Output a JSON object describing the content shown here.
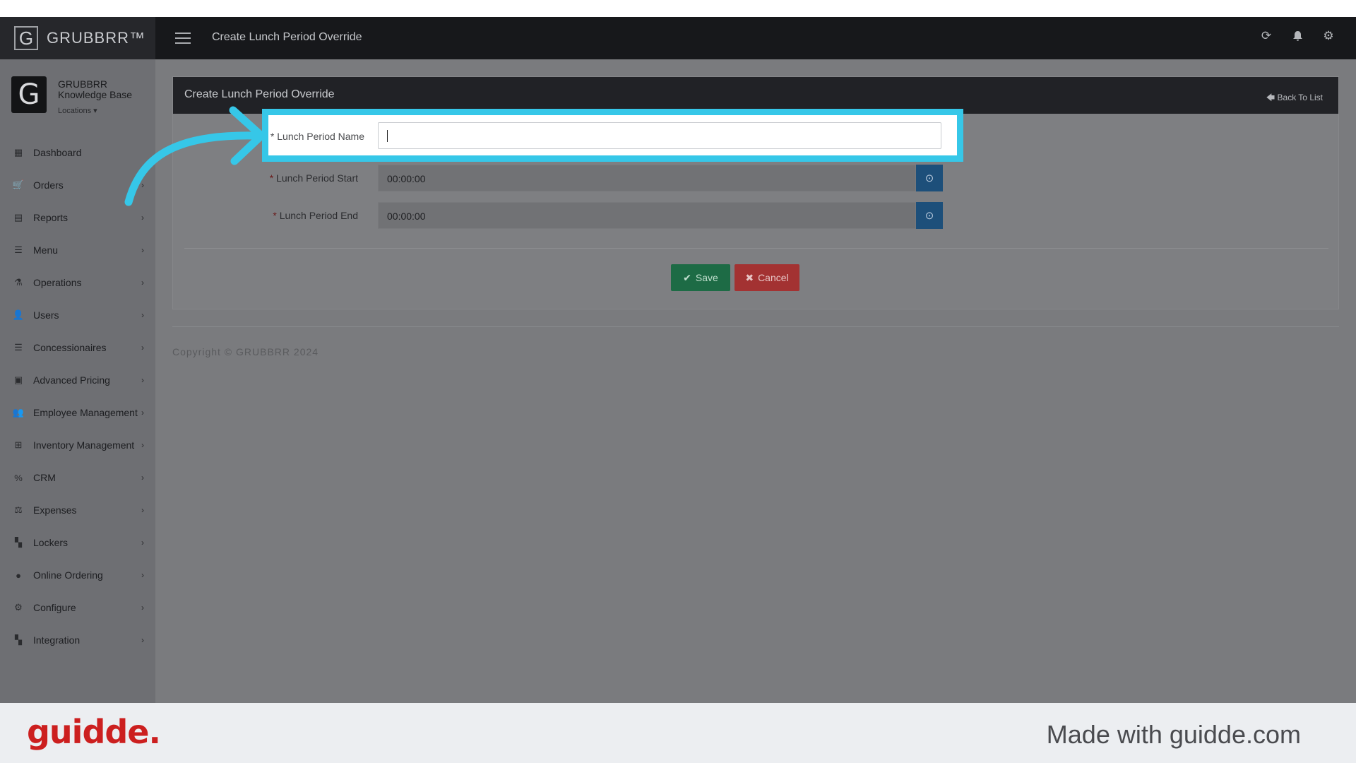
{
  "app": {
    "brand_name": "GRUBBRR™",
    "brand_logo": "G",
    "page_title": "Create Lunch Period Override"
  },
  "topbar_icons": [
    "refresh-icon",
    "bell-icon",
    "gear-icon"
  ],
  "profile": {
    "avatar_letter": "G",
    "name": "GRUBBRR Knowledge Base",
    "locations_label": "Locations ▾"
  },
  "sidebar": {
    "items": [
      {
        "label": "Dashboard",
        "icon": "dashboard-icon",
        "glyph": "▦",
        "chevron": ""
      },
      {
        "label": "Orders",
        "icon": "cart-icon",
        "glyph": "🛒",
        "chevron": "›"
      },
      {
        "label": "Reports",
        "icon": "report-icon",
        "glyph": "▤",
        "chevron": "›"
      },
      {
        "label": "Menu",
        "icon": "menu-list-icon",
        "glyph": "☰",
        "chevron": "›"
      },
      {
        "label": "Operations",
        "icon": "flask-icon",
        "glyph": "⚗",
        "chevron": "›"
      },
      {
        "label": "Users",
        "icon": "user-add-icon",
        "glyph": "👤",
        "chevron": "›"
      },
      {
        "label": "Concessionaires",
        "icon": "list-icon",
        "glyph": "☰",
        "chevron": "›"
      },
      {
        "label": "Advanced Pricing",
        "icon": "money-icon",
        "glyph": "▣",
        "chevron": "›"
      },
      {
        "label": "Employee Management",
        "icon": "users-icon",
        "glyph": "👥",
        "chevron": "›"
      },
      {
        "label": "Inventory Management",
        "icon": "sitemap-icon",
        "glyph": "⊞",
        "chevron": "›"
      },
      {
        "label": "CRM",
        "icon": "link-icon",
        "glyph": "%",
        "chevron": "›"
      },
      {
        "label": "Expenses",
        "icon": "balance-icon",
        "glyph": "⚖",
        "chevron": "›"
      },
      {
        "label": "Lockers",
        "icon": "lockers-icon",
        "glyph": "▚",
        "chevron": "›"
      },
      {
        "label": "Online Ordering",
        "icon": "globe-icon",
        "glyph": "●",
        "chevron": "›"
      },
      {
        "label": "Configure",
        "icon": "cog-icon",
        "glyph": "⚙",
        "chevron": "›"
      },
      {
        "label": "Integration",
        "icon": "plug-icon",
        "glyph": "▚",
        "chevron": "›"
      }
    ]
  },
  "panel": {
    "title": "Create Lunch Period Override",
    "back_label": "🡄 Back To List"
  },
  "form": {
    "name_label": "* Lunch Period Name",
    "name_value": "",
    "start_label": "Lunch Period Start",
    "start_value": "00:00:00",
    "end_label": "Lunch Period End",
    "end_value": "00:00:00",
    "required_mark": "* "
  },
  "actions": {
    "save_label": "Save",
    "cancel_label": "Cancel"
  },
  "footer": {
    "copyright": "Copyright © GRUBBRR 2024"
  },
  "watermark": {
    "logo": "guidde.",
    "made_with": "Made with guidde.com"
  },
  "colors": {
    "highlight": "#36c7e8",
    "save": "#1d6b45",
    "cancel": "#a33232",
    "time_button": "#1d4f7a"
  }
}
